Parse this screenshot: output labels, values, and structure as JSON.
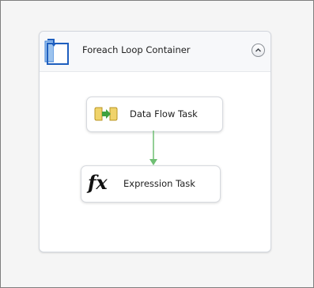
{
  "container": {
    "title": "Foreach Loop Container",
    "icon": "foreach-loop-container-icon",
    "collapse_icon": "chevron-up-icon"
  },
  "tasks": [
    {
      "label": "Data Flow Task",
      "icon": "data-flow-task-icon"
    },
    {
      "label": "Expression Task",
      "icon": "expression-task-icon",
      "icon_glyph": "fx"
    }
  ],
  "connector": {
    "type": "precedence-constraint",
    "status": "success",
    "color": "#6fbf73"
  },
  "colors": {
    "canvas_bg": "#f5f5f5",
    "container_border": "#d3d7de",
    "icon_blue": "#2b6fd6",
    "icon_yellow": "#e8c14a",
    "icon_green": "#3fa13f"
  }
}
